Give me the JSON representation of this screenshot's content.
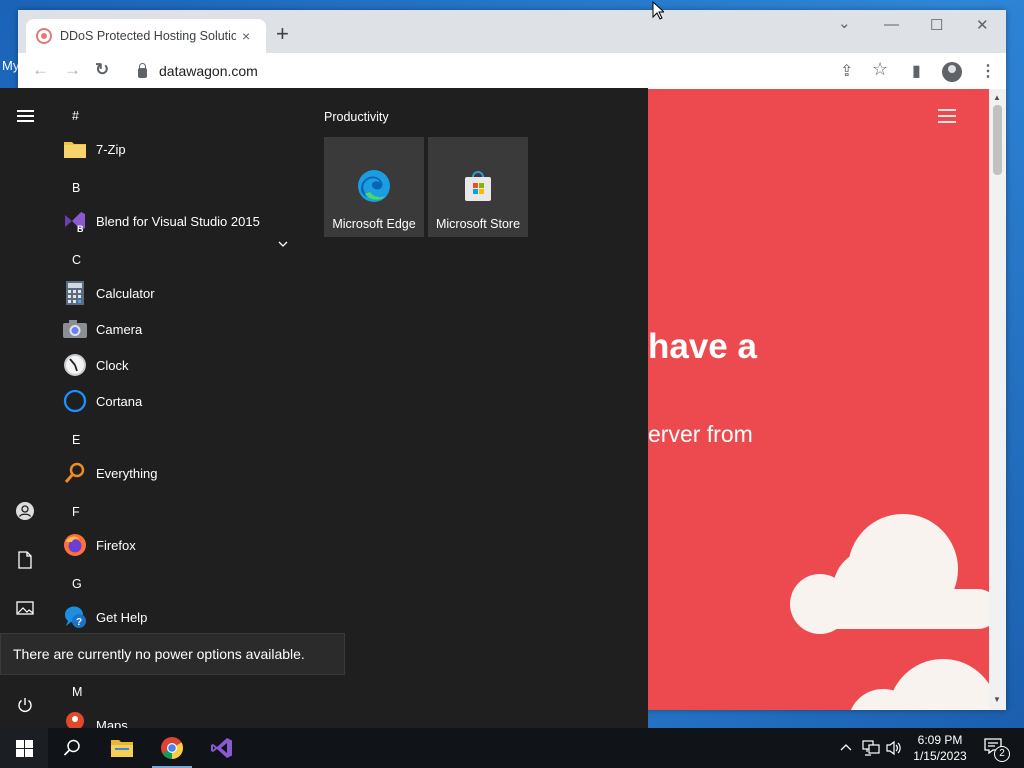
{
  "desktop": {
    "partial_label": "My"
  },
  "browser": {
    "tab": {
      "title": "DDoS Protected Hosting Solutions",
      "close": "×"
    },
    "new_tab": "+",
    "window_controls": {
      "tab_search": "⌄",
      "minimize": "—",
      "maximize": "☐",
      "close": "✕"
    },
    "toolbar": {
      "back": "←",
      "forward": "→",
      "reload": "↻",
      "url": "datawagon.com",
      "share": "⇪",
      "bookmark": "☆",
      "sidepanel": "▮",
      "menu": "⋮"
    },
    "page": {
      "hero_fragment": "have a",
      "sub_fragment": "erver from"
    },
    "scroll": {
      "up": "▲",
      "down": "▼"
    }
  },
  "start_menu": {
    "groups": [
      {
        "letter": "#",
        "apps": [
          {
            "label": "7-Zip",
            "icon": "folder-icon",
            "expandable": true
          }
        ]
      },
      {
        "letter": "B",
        "apps": [
          {
            "label": "Blend for Visual Studio 2015",
            "icon": "blend-icon"
          }
        ]
      },
      {
        "letter": "C",
        "apps": [
          {
            "label": "Calculator",
            "icon": "calculator-icon"
          },
          {
            "label": "Camera",
            "icon": "camera-icon"
          },
          {
            "label": "Clock",
            "icon": "clock-icon"
          },
          {
            "label": "Cortana",
            "icon": "cortana-icon"
          }
        ]
      },
      {
        "letter": "E",
        "apps": [
          {
            "label": "Everything",
            "icon": "everything-icon"
          }
        ]
      },
      {
        "letter": "F",
        "apps": [
          {
            "label": "Firefox",
            "icon": "firefox-icon"
          }
        ]
      },
      {
        "letter": "G",
        "apps": [
          {
            "label": "Get Help",
            "icon": "help-icon"
          }
        ]
      },
      {
        "letter": "M",
        "apps": [
          {
            "label": "Maps",
            "icon": "maps-icon"
          }
        ]
      }
    ],
    "tile_group_title": "Productivity",
    "tiles": [
      {
        "label": "Microsoft Edge",
        "icon": "edge-icon"
      },
      {
        "label": "Microsoft Store",
        "icon": "store-icon"
      }
    ],
    "tooltip": "There are currently no power options available."
  },
  "taskbar": {
    "clock_time": "6:09 PM",
    "clock_date": "1/15/2023",
    "notification_count": "2",
    "tray_chevron": "^"
  }
}
